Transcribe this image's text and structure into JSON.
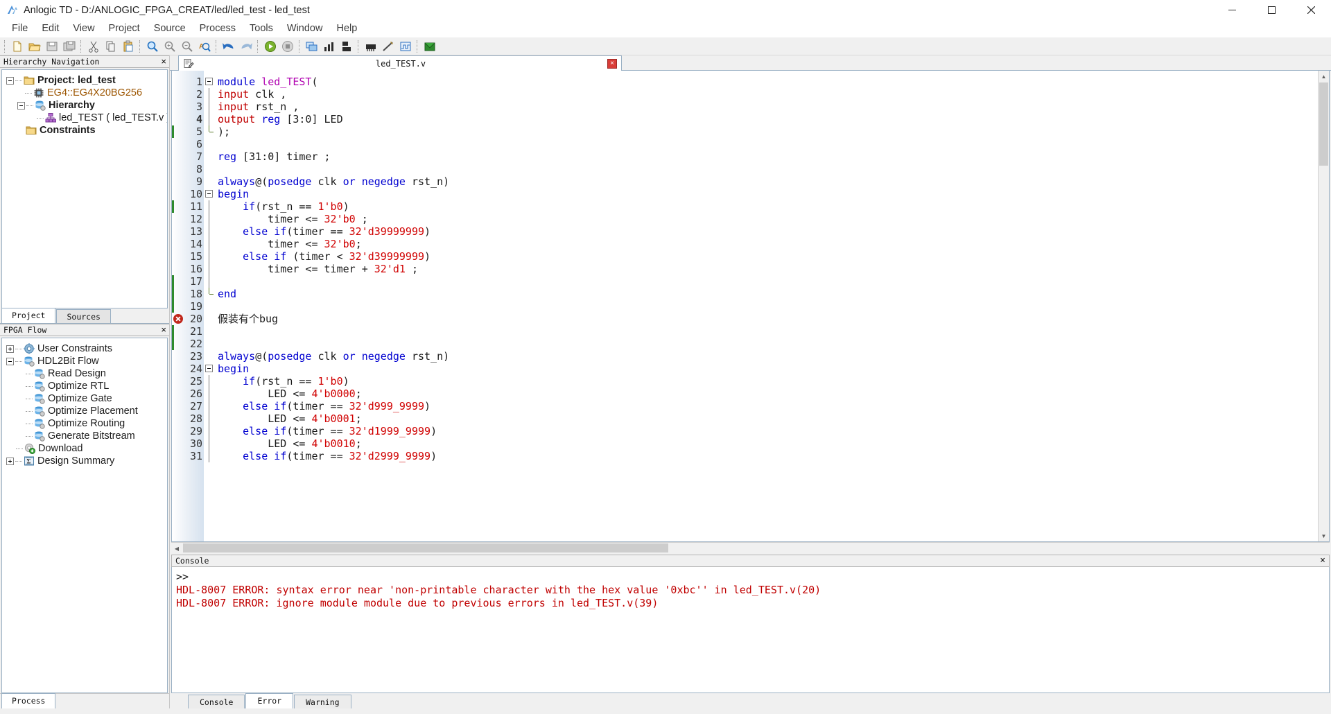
{
  "window": {
    "title": "Anlogic TD - D:/ANLOGIC_FPGA_CREAT/led/led_test - led_test",
    "minimize_label": "─",
    "maximize_label": "☐",
    "close_label": "✕"
  },
  "menubar": {
    "items": [
      {
        "label": "File"
      },
      {
        "label": "Edit"
      },
      {
        "label": "View"
      },
      {
        "label": "Project"
      },
      {
        "label": "Source"
      },
      {
        "label": "Process"
      },
      {
        "label": "Tools"
      },
      {
        "label": "Window"
      },
      {
        "label": "Help"
      }
    ]
  },
  "toolbar": {
    "buttons": [
      {
        "name": "new-file-icon"
      },
      {
        "name": "open-folder-icon"
      },
      {
        "name": "save-icon"
      },
      {
        "name": "save-all-icon"
      },
      {
        "name": "cut-icon"
      },
      {
        "name": "copy-icon"
      },
      {
        "name": "paste-icon"
      },
      {
        "name": "find-icon"
      },
      {
        "name": "zoom-in-icon"
      },
      {
        "name": "zoom-out-icon"
      },
      {
        "name": "find-replace-icon"
      },
      {
        "name": "undo-icon"
      },
      {
        "name": "redo-icon"
      },
      {
        "name": "run-icon"
      },
      {
        "name": "stop-icon"
      },
      {
        "name": "rtl-view-icon"
      },
      {
        "name": "report-chart-icon"
      },
      {
        "name": "floorplan-icon"
      },
      {
        "name": "device-icon"
      },
      {
        "name": "timing-icon"
      },
      {
        "name": "waveform-icon"
      },
      {
        "name": "download-icon"
      }
    ]
  },
  "hierarchy_panel": {
    "title": "Hierarchy Navigation",
    "close_label": "×",
    "nodes": [
      {
        "label": "Project: led_test",
        "icon": "folder-icon",
        "bold": true,
        "indent": 0,
        "expander": "minus"
      },
      {
        "label": "EG4::EG4X20BG256",
        "icon": "chip-icon",
        "bold": false,
        "indent": 1,
        "expander": "none",
        "color": "orange"
      },
      {
        "label": "Hierarchy",
        "icon": "database-icon",
        "bold": true,
        "indent": 1,
        "expander": "minus"
      },
      {
        "label": "led_TEST ( led_TEST.v )",
        "icon": "module-icon",
        "bold": false,
        "indent": 2,
        "expander": "none"
      },
      {
        "label": "Constraints",
        "icon": "folder-icon",
        "bold": true,
        "indent": 1,
        "expander": "none"
      }
    ],
    "tabs": [
      {
        "label": "Project",
        "active": true
      },
      {
        "label": "Sources",
        "active": false
      }
    ]
  },
  "flow_panel": {
    "title": "FPGA Flow",
    "close_label": "×",
    "nodes": [
      {
        "label": "User Constraints",
        "icon": "gear-icon",
        "indent": 0,
        "expander": "plus"
      },
      {
        "label": "HDL2Bit Flow",
        "icon": "database-icon",
        "indent": 0,
        "expander": "minus"
      },
      {
        "label": "Read Design",
        "icon": "database-icon",
        "indent": 1,
        "expander": "none"
      },
      {
        "label": "Optimize RTL",
        "icon": "database-icon",
        "indent": 1,
        "expander": "none"
      },
      {
        "label": "Optimize Gate",
        "icon": "database-icon",
        "indent": 1,
        "expander": "none"
      },
      {
        "label": "Optimize Placement",
        "icon": "database-icon",
        "indent": 1,
        "expander": "none"
      },
      {
        "label": "Optimize Routing",
        "icon": "database-icon",
        "indent": 1,
        "expander": "none"
      },
      {
        "label": "Generate Bitstream",
        "icon": "database-icon",
        "indent": 1,
        "expander": "none"
      },
      {
        "label": "Download",
        "icon": "download-gear-icon",
        "indent": 0,
        "expander": "none"
      },
      {
        "label": "Design Summary",
        "icon": "sigma-icon",
        "indent": 0,
        "expander": "plus"
      }
    ],
    "process_tab": "Process"
  },
  "editor": {
    "tab_title": "led_TEST.v",
    "tab_icon": "text-file-icon",
    "close_label": "×",
    "current_line": 4,
    "error_line": 20,
    "lines": [
      {
        "n": 1,
        "fold": "open",
        "tokens": [
          {
            "t": "module",
            "c": "kw"
          },
          {
            "t": " ",
            "c": "plain"
          },
          {
            "t": "led_TEST",
            "c": "mod"
          },
          {
            "t": "(",
            "c": "plain"
          }
        ]
      },
      {
        "n": 2,
        "fold": "bar",
        "tokens": [
          {
            "t": "input",
            "c": "kw2"
          },
          {
            "t": " clk ,",
            "c": "plain"
          }
        ]
      },
      {
        "n": 3,
        "fold": "bar",
        "tokens": [
          {
            "t": "input",
            "c": "kw2"
          },
          {
            "t": " rst_n ,",
            "c": "plain"
          }
        ]
      },
      {
        "n": 4,
        "fold": "bar",
        "tokens": [
          {
            "t": "output",
            "c": "kw2"
          },
          {
            "t": " ",
            "c": "plain"
          },
          {
            "t": "reg",
            "c": "kw"
          },
          {
            "t": " [3:0] LED",
            "c": "plain"
          }
        ]
      },
      {
        "n": 5,
        "fold": "end",
        "change": true,
        "tokens": [
          {
            "t": ");",
            "c": "plain"
          }
        ]
      },
      {
        "n": 6,
        "fold": "",
        "tokens": []
      },
      {
        "n": 7,
        "fold": "",
        "tokens": [
          {
            "t": "reg",
            "c": "kw"
          },
          {
            "t": " [31:0] timer ;",
            "c": "plain"
          }
        ]
      },
      {
        "n": 8,
        "fold": "",
        "tokens": []
      },
      {
        "n": 9,
        "fold": "",
        "tokens": [
          {
            "t": "always",
            "c": "kw"
          },
          {
            "t": "@(",
            "c": "plain"
          },
          {
            "t": "posedge",
            "c": "kw"
          },
          {
            "t": " clk ",
            "c": "plain"
          },
          {
            "t": "or",
            "c": "kw"
          },
          {
            "t": " ",
            "c": "plain"
          },
          {
            "t": "negedge",
            "c": "kw"
          },
          {
            "t": " rst_n)",
            "c": "plain"
          }
        ]
      },
      {
        "n": 10,
        "fold": "open",
        "tokens": [
          {
            "t": "begin",
            "c": "kw"
          }
        ]
      },
      {
        "n": 11,
        "fold": "bar",
        "change": true,
        "tokens": [
          {
            "t": "    ",
            "c": "plain"
          },
          {
            "t": "if",
            "c": "kw"
          },
          {
            "t": "(rst_n == ",
            "c": "plain"
          },
          {
            "t": "1'b0",
            "c": "num"
          },
          {
            "t": ")",
            "c": "plain"
          }
        ]
      },
      {
        "n": 12,
        "fold": "bar",
        "tokens": [
          {
            "t": "        timer <= ",
            "c": "plain"
          },
          {
            "t": "32'b0",
            "c": "num"
          },
          {
            "t": " ;",
            "c": "plain"
          }
        ]
      },
      {
        "n": 13,
        "fold": "bar",
        "tokens": [
          {
            "t": "    ",
            "c": "plain"
          },
          {
            "t": "else if",
            "c": "kw"
          },
          {
            "t": "(timer == ",
            "c": "plain"
          },
          {
            "t": "32'd39999999",
            "c": "num"
          },
          {
            "t": ")",
            "c": "plain"
          }
        ]
      },
      {
        "n": 14,
        "fold": "bar",
        "tokens": [
          {
            "t": "        timer <= ",
            "c": "plain"
          },
          {
            "t": "32'b0",
            "c": "num"
          },
          {
            "t": ";",
            "c": "plain"
          }
        ]
      },
      {
        "n": 15,
        "fold": "bar",
        "tokens": [
          {
            "t": "    ",
            "c": "plain"
          },
          {
            "t": "else if",
            "c": "kw"
          },
          {
            "t": " (timer < ",
            "c": "plain"
          },
          {
            "t": "32'd39999999",
            "c": "num"
          },
          {
            "t": ")",
            "c": "plain"
          }
        ]
      },
      {
        "n": 16,
        "fold": "bar",
        "tokens": [
          {
            "t": "        timer <= timer + ",
            "c": "plain"
          },
          {
            "t": "32'd1",
            "c": "num"
          },
          {
            "t": " ;",
            "c": "plain"
          }
        ]
      },
      {
        "n": 17,
        "fold": "bar",
        "change": true,
        "tokens": []
      },
      {
        "n": 18,
        "fold": "end",
        "change": true,
        "tokens": [
          {
            "t": "end",
            "c": "kw"
          }
        ]
      },
      {
        "n": 19,
        "fold": "",
        "change": true,
        "tokens": []
      },
      {
        "n": 20,
        "fold": "",
        "error": true,
        "tokens": [
          {
            "t": "假装有个bug",
            "c": "plain"
          }
        ]
      },
      {
        "n": 21,
        "fold": "",
        "change": true,
        "tokens": []
      },
      {
        "n": 22,
        "fold": "",
        "change": true,
        "tokens": []
      },
      {
        "n": 23,
        "fold": "",
        "tokens": [
          {
            "t": "always",
            "c": "kw"
          },
          {
            "t": "@(",
            "c": "plain"
          },
          {
            "t": "posedge",
            "c": "kw"
          },
          {
            "t": " clk ",
            "c": "plain"
          },
          {
            "t": "or",
            "c": "kw"
          },
          {
            "t": " ",
            "c": "plain"
          },
          {
            "t": "negedge",
            "c": "kw"
          },
          {
            "t": " rst_n)",
            "c": "plain"
          }
        ]
      },
      {
        "n": 24,
        "fold": "open",
        "tokens": [
          {
            "t": "begin",
            "c": "kw"
          }
        ]
      },
      {
        "n": 25,
        "fold": "bar",
        "tokens": [
          {
            "t": "    ",
            "c": "plain"
          },
          {
            "t": "if",
            "c": "kw"
          },
          {
            "t": "(rst_n == ",
            "c": "plain"
          },
          {
            "t": "1'b0",
            "c": "num"
          },
          {
            "t": ")",
            "c": "plain"
          }
        ]
      },
      {
        "n": 26,
        "fold": "bar",
        "tokens": [
          {
            "t": "        LED <= ",
            "c": "plain"
          },
          {
            "t": "4'b0000",
            "c": "num"
          },
          {
            "t": ";",
            "c": "plain"
          }
        ]
      },
      {
        "n": 27,
        "fold": "bar",
        "tokens": [
          {
            "t": "    ",
            "c": "plain"
          },
          {
            "t": "else if",
            "c": "kw"
          },
          {
            "t": "(timer == ",
            "c": "plain"
          },
          {
            "t": "32'd999_9999",
            "c": "num"
          },
          {
            "t": ")",
            "c": "plain"
          }
        ]
      },
      {
        "n": 28,
        "fold": "bar",
        "tokens": [
          {
            "t": "        LED <= ",
            "c": "plain"
          },
          {
            "t": "4'b0001",
            "c": "num"
          },
          {
            "t": ";",
            "c": "plain"
          }
        ]
      },
      {
        "n": 29,
        "fold": "bar",
        "tokens": [
          {
            "t": "    ",
            "c": "plain"
          },
          {
            "t": "else if",
            "c": "kw"
          },
          {
            "t": "(timer == ",
            "c": "plain"
          },
          {
            "t": "32'd1999_9999",
            "c": "num"
          },
          {
            "t": ")",
            "c": "plain"
          }
        ]
      },
      {
        "n": 30,
        "fold": "bar",
        "tokens": [
          {
            "t": "        LED <= ",
            "c": "plain"
          },
          {
            "t": "4'b0010",
            "c": "num"
          },
          {
            "t": ";",
            "c": "plain"
          }
        ]
      },
      {
        "n": 31,
        "fold": "bar",
        "tokens": [
          {
            "t": "    ",
            "c": "plain"
          },
          {
            "t": "else if",
            "c": "kw"
          },
          {
            "t": "(timer == ",
            "c": "plain"
          },
          {
            "t": "32'd2999_9999",
            "c": "num"
          },
          {
            "t": ")",
            "c": "plain"
          }
        ]
      }
    ]
  },
  "console": {
    "title": "Console",
    "close_label": "×",
    "lines": [
      {
        "text": ">>",
        "error": false
      },
      {
        "text": "HDL-8007 ERROR: syntax error near 'non-printable character with the hex value '0xbc'' in led_TEST.v(20)",
        "error": true
      },
      {
        "text": "HDL-8007 ERROR: ignore module module due to previous errors in led_TEST.v(39)",
        "error": true
      }
    ],
    "tabs": [
      {
        "label": "Console",
        "active": false
      },
      {
        "label": "Error",
        "active": true
      },
      {
        "label": "Warning",
        "active": false
      }
    ]
  },
  "colors": {
    "keyword": "#0000d0",
    "type": "#c00000",
    "number": "#d00000",
    "module": "#b000b0",
    "error": "#c00000",
    "accent": "#9ab0c4"
  }
}
